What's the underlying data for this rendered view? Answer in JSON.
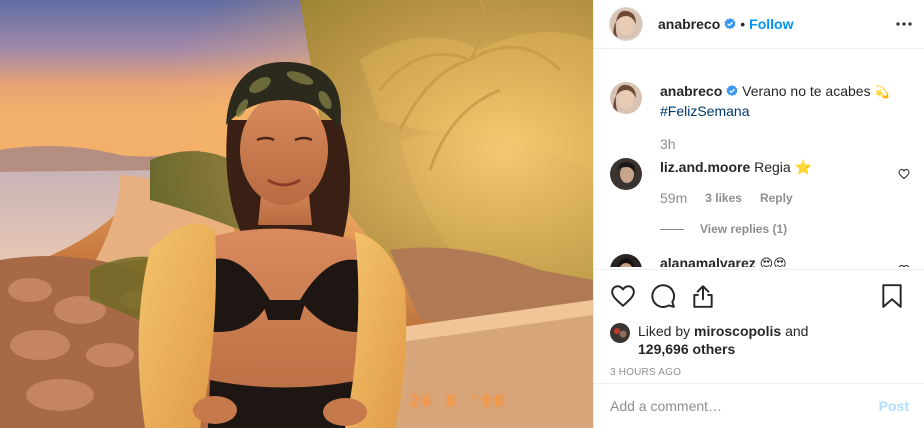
{
  "photo": {
    "alt_date_stamp": "26 8 '98"
  },
  "header": {
    "username": "anabreco",
    "separator": "•",
    "follow_label": "Follow"
  },
  "caption": {
    "username": "anabreco",
    "text": "Verano no te acabes",
    "emoji": "💫",
    "hashtag": "#FelizSemana",
    "time": "3h"
  },
  "comments": [
    {
      "username": "liz.and.moore",
      "text": "Regia",
      "emoji": "⭐",
      "time": "59m",
      "likes": "3 likes",
      "reply_label": "Reply",
      "view_replies": "View replies (1)"
    },
    {
      "username": "alanamalvarez",
      "emoji": "😍😍"
    }
  ],
  "likes": {
    "prefix": "Liked by",
    "liker": "miroscopolis",
    "connector": "and",
    "others": "129,696 others"
  },
  "posted_ago": "3 HOURS AGO",
  "add_comment": {
    "placeholder": "Add a comment…",
    "post_label": "Post"
  },
  "colors": {
    "link_blue": "#0095f6",
    "verified_blue": "#3897f0",
    "muted_gray": "#8e8e8e",
    "post_disabled": "#b2dffc"
  },
  "icons": [
    "verified-badge-icon",
    "more-options-icon",
    "heart-icon",
    "comment-icon",
    "share-icon",
    "bookmark-icon"
  ]
}
